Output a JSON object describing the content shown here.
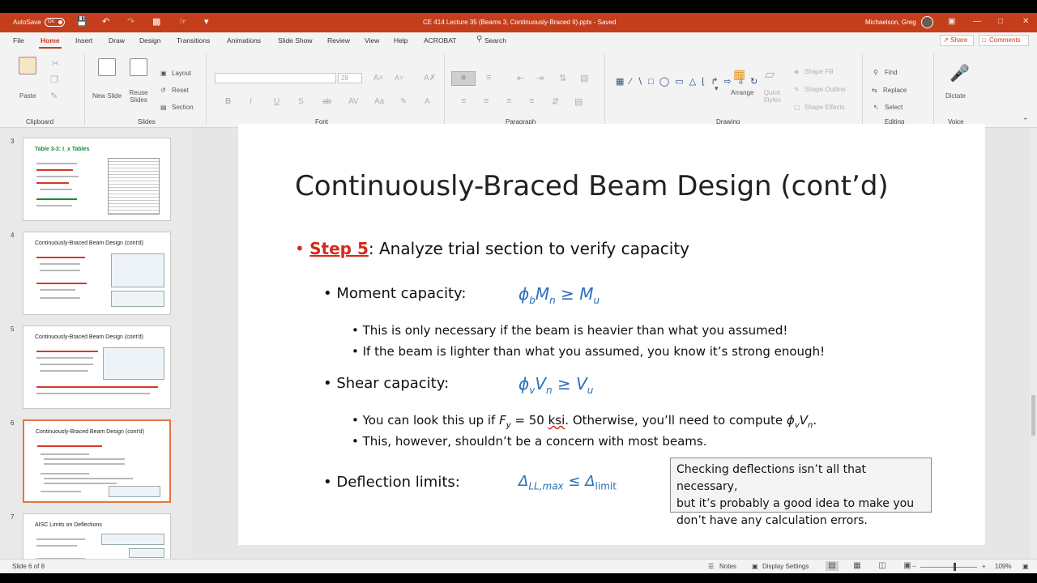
{
  "titlebar": {
    "autosave_label": "AutoSave",
    "autosave_state": "On",
    "document_title": "CE 414 Lecture 35 (Beams 3, Continuously-Braced II).pptx  -  Saved",
    "user": "Michaelson, Greg"
  },
  "menu": {
    "tabs": [
      "File",
      "Home",
      "Insert",
      "Draw",
      "Design",
      "Transitions",
      "Animations",
      "Slide Show",
      "Review",
      "View",
      "Help",
      "ACROBAT"
    ],
    "active_tab": "Home",
    "search_label": "Search",
    "share_label": "Share",
    "comments_label": "Comments"
  },
  "ribbon": {
    "clipboard": {
      "label": "Clipboard",
      "paste": "Paste"
    },
    "slides": {
      "label": "Slides",
      "new_slide": "New Slide",
      "reuse_slides": "Reuse Slides",
      "layout": "Layout",
      "reset": "Reset",
      "section": "Section"
    },
    "font": {
      "label": "Font",
      "size": "28"
    },
    "paragraph": {
      "label": "Paragraph"
    },
    "drawing": {
      "label": "Drawing",
      "arrange": "Arrange",
      "quick_styles": "Quick Styles",
      "shape_fill": "Shape Fill",
      "shape_outline": "Shape Outline",
      "shape_effects": "Shape Effects"
    },
    "editing": {
      "label": "Editing",
      "find": "Find",
      "replace": "Replace",
      "select": "Select"
    },
    "voice": {
      "label": "Voice",
      "dictate": "Dictate"
    }
  },
  "thumbnails": [
    {
      "num": "3",
      "title": "Table 3-3: I_x Tables"
    },
    {
      "num": "4",
      "title": "Continuously-Braced Beam Design (cont'd)"
    },
    {
      "num": "5",
      "title": "Continuously-Braced Beam Design (cont'd)"
    },
    {
      "num": "6",
      "title": "Continuously-Braced Beam Design (cont'd)"
    },
    {
      "num": "7",
      "title": "AISC Limits on Deflections"
    }
  ],
  "slide": {
    "title": "Continuously-Braced Beam Design (cont’d)",
    "step_label": "Step 5",
    "step_text": ":  Analyze trial section to verify capacity",
    "moment_label": "Moment capacity:",
    "moment_formula": {
      "phi": "ϕ",
      "phi_sub": "b",
      "var": "M",
      "var_sub": "n",
      "rel": " ≥ ",
      "rhs": "M",
      "rhs_sub": "u"
    },
    "moment_sub1": "This is only necessary if the beam is heavier than what you assumed!",
    "moment_sub2": "If the beam is lighter than what you assumed, you know it’s strong enough!",
    "shear_label": "Shear capacity:",
    "shear_formula": {
      "phi": "ϕ",
      "phi_sub": "v",
      "var": "V",
      "var_sub": "n",
      "rel": " ≥ ",
      "rhs": "V",
      "rhs_sub": "u"
    },
    "shear_sub1_a": "You can look this up if ",
    "shear_sub1_f": "F",
    "shear_sub1_fsub": "y",
    "shear_sub1_b": " = 50 ",
    "shear_sub1_ksi": "ksi",
    "shear_sub1_c": ".  Otherwise, you’ll need to compute ",
    "shear_sub1_phi": "ϕ",
    "shear_sub1_phisub": "v",
    "shear_sub1_v": "V",
    "shear_sub1_vsub": "n",
    "shear_sub1_end": ".",
    "shear_sub2": "This, however, shouldn’t be a concern with most beams.",
    "deflection_label": "Deflection limits:",
    "deflection_formula": {
      "delta": "Δ",
      "delta_sub": "LL,max",
      "rel": " ≤ ",
      "rhs": "Δ",
      "rhs_sub": "limit"
    },
    "note": "Checking deflections isn’t all that necessary,\nbut it’s probably a good idea to make you\ndon’t have any calculation errors."
  },
  "status": {
    "slide_counter": "Slide 6 of 8",
    "notes": "Notes",
    "display_settings": "Display Settings",
    "zoom": "109%",
    "zoom_fraction": 0.6
  },
  "colors": {
    "accent": "#c43e1c",
    "formula_blue": "#2a6fba",
    "step_red": "#d42a1c",
    "selected_thumb": "#e2763f"
  }
}
